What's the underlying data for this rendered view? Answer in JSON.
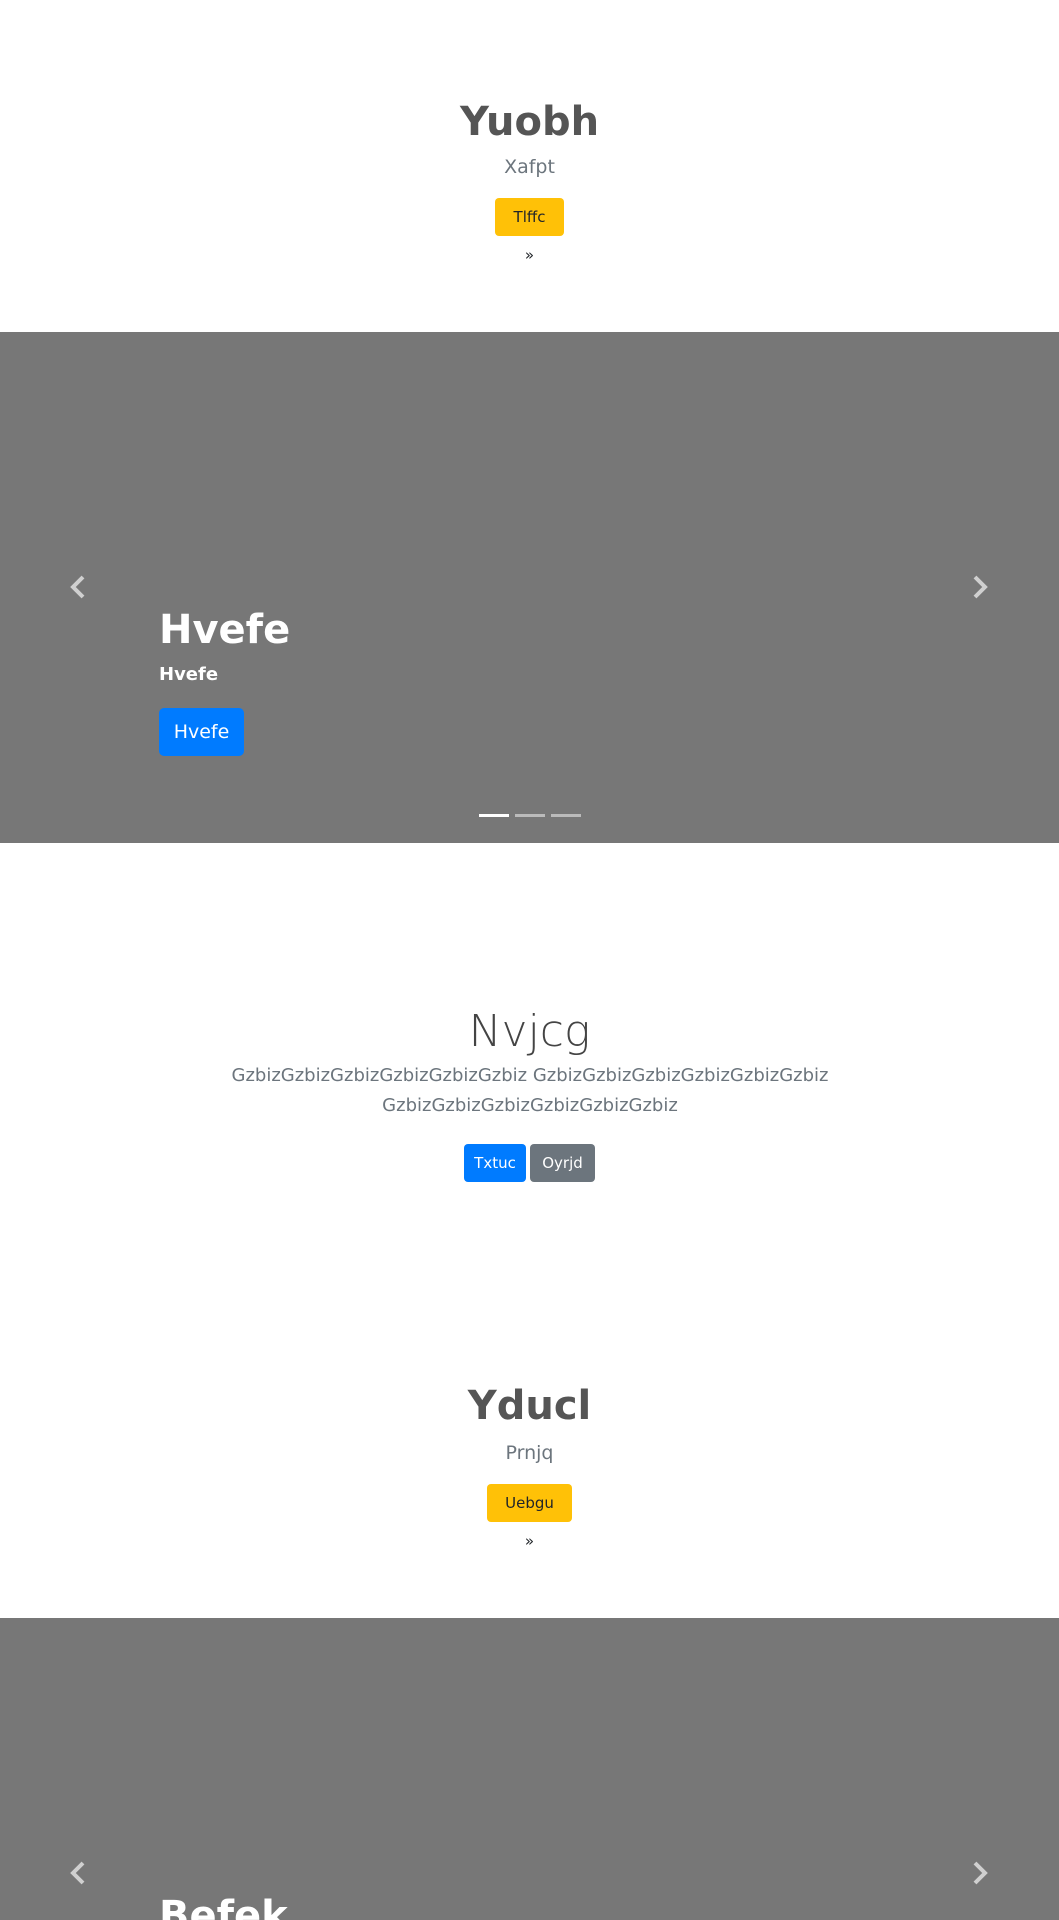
{
  "cta1": {
    "title": "Yuobh",
    "subtitle": "Xafpt",
    "button_label": "Tlffc »"
  },
  "carousel1": {
    "slide_title": "Hvefe",
    "slide_subtitle": "Hvefe",
    "button_label": "Hvefe",
    "prev_icon": "chevron-left-icon",
    "next_icon": "chevron-right-icon",
    "indicator_count": 3,
    "active_indicator": 1
  },
  "hero": {
    "title": "Nvjcg",
    "lead": "GzbizGzbizGzbizGzbizGzbizGzbiz GzbizGzbizGzbizGzbizGzbizGzbiz GzbizGzbizGzbizGzbizGzbizGzbiz",
    "primary_button": "Txtuc",
    "secondary_button": "Oyrjd"
  },
  "cta2": {
    "title": "Yducl",
    "subtitle": "Prnjq",
    "button_label": "Uebgu »"
  },
  "carousel2": {
    "slide_title": "Befek",
    "prev_icon": "chevron-left-icon",
    "next_icon": "chevron-right-icon"
  },
  "colors": {
    "primary": "#007bff",
    "secondary": "#6c757d",
    "warning": "#ffc107",
    "carousel_bg": "#777777"
  }
}
